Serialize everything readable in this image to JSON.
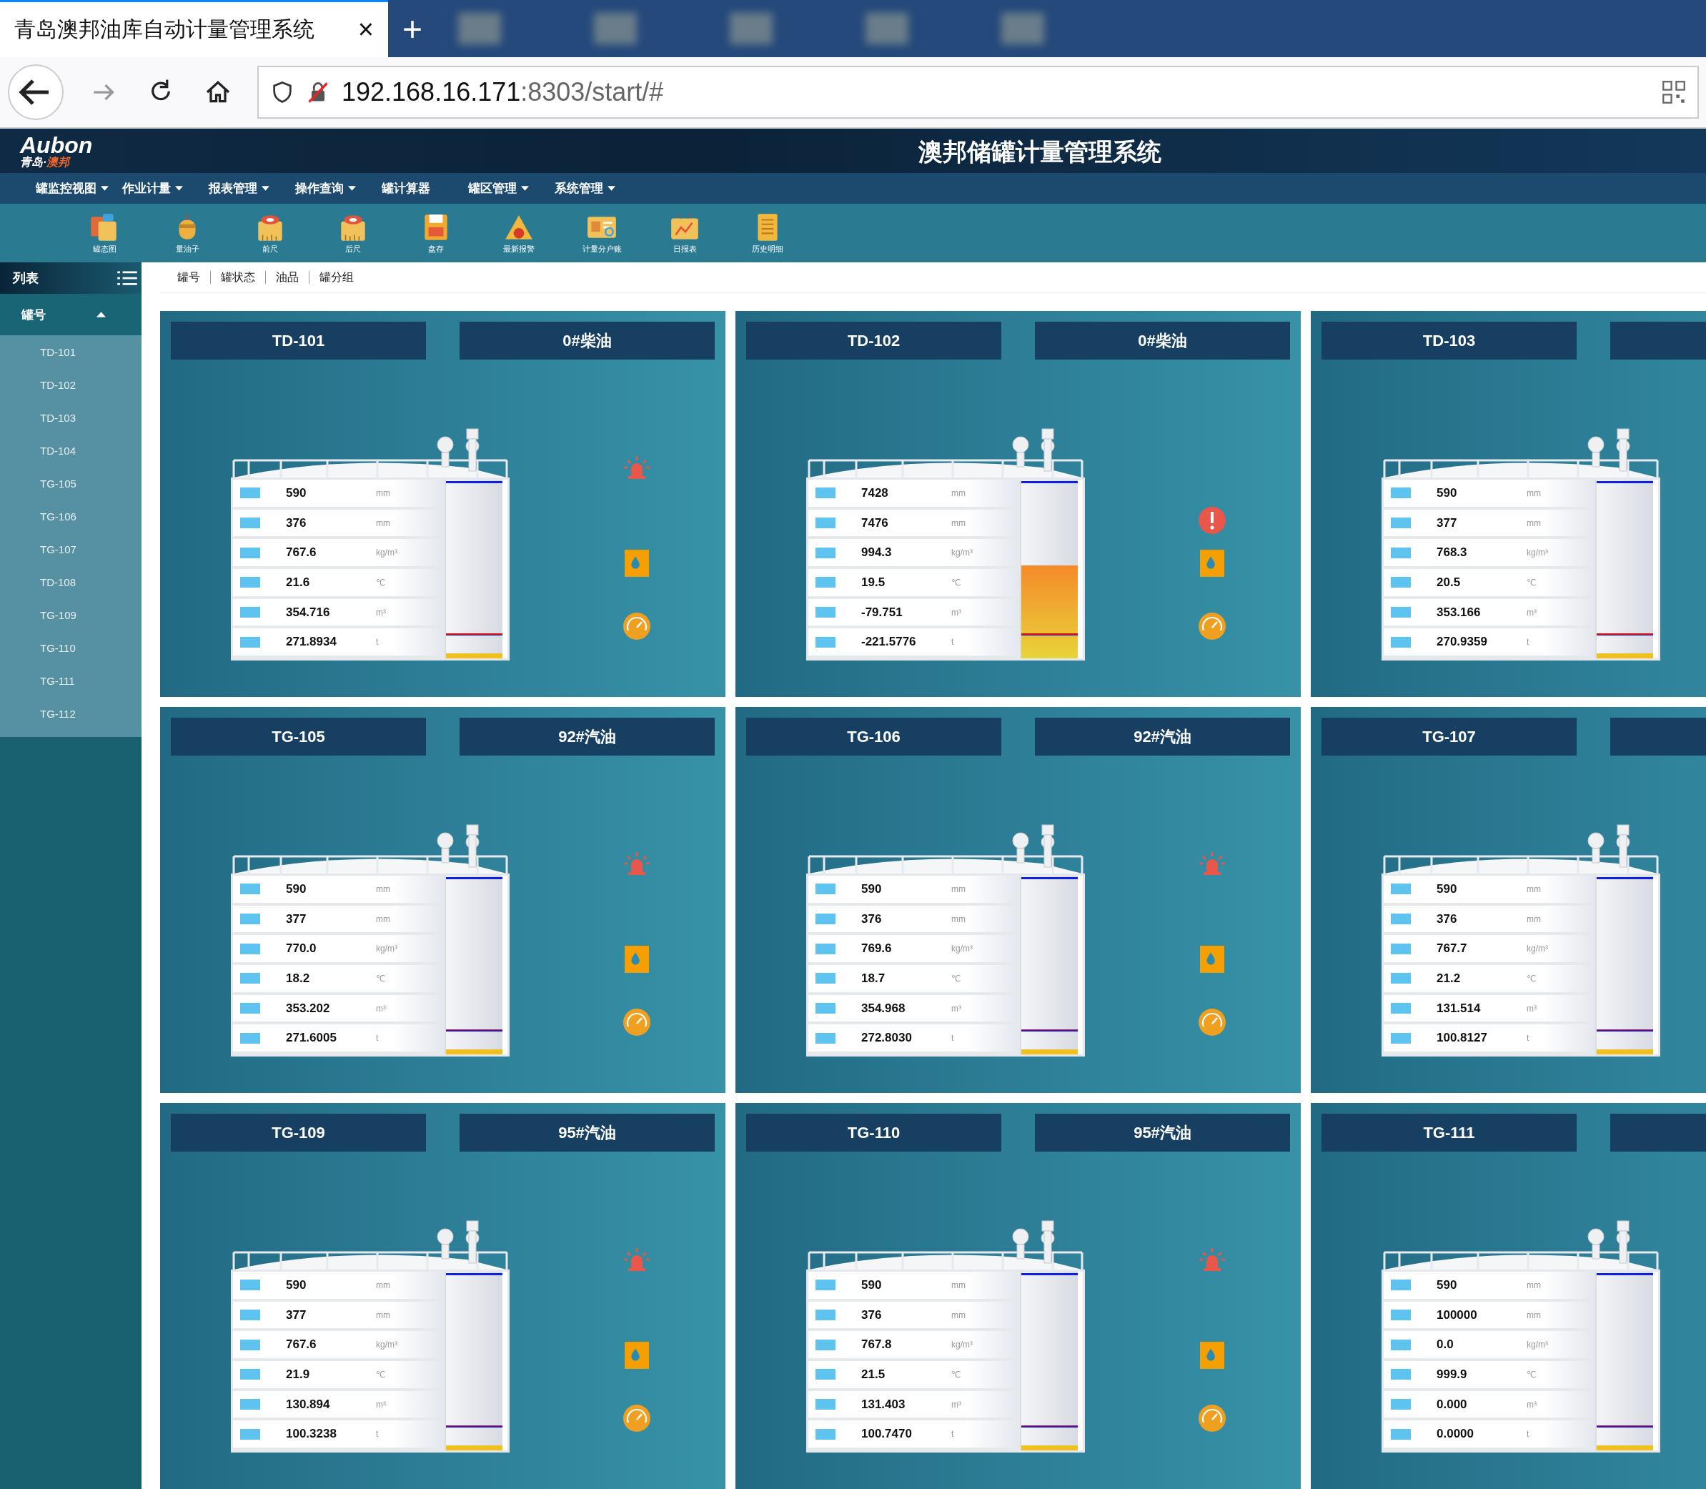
{
  "browser": {
    "tab_title": "青岛澳邦油库自动计量管理系统",
    "tab_close": "×",
    "new_tab": "+",
    "url_host": "192.168.16.171",
    "url_rest": ":8303/start/#"
  },
  "header": {
    "logo": "Aubon",
    "logo_sub": "青岛·",
    "logo_sub_accent": "澳邦",
    "title": "澳邦储罐计量管理系统"
  },
  "menu": [
    {
      "label": "罐监控视图",
      "dropdown": true
    },
    {
      "label": "作业计量",
      "dropdown": true
    },
    {
      "label": "报表管理",
      "dropdown": true
    },
    {
      "label": "操作查询",
      "dropdown": true
    },
    {
      "label": "罐计算器",
      "dropdown": false
    },
    {
      "label": "罐区管理",
      "dropdown": true
    },
    {
      "label": "系统管理",
      "dropdown": true
    }
  ],
  "toolbar": [
    {
      "label": "罐态图",
      "kind": "tanks"
    },
    {
      "label": "量油子",
      "kind": "drum"
    },
    {
      "label": "前尺",
      "kind": "ruler"
    },
    {
      "label": "后尺",
      "kind": "ruler"
    },
    {
      "label": "盘存",
      "kind": "save"
    },
    {
      "label": "最新报警",
      "kind": "warning"
    },
    {
      "label": "计量分户账",
      "kind": "card"
    },
    {
      "label": "日报表",
      "kind": "report"
    },
    {
      "label": "历史明细",
      "kind": "list"
    }
  ],
  "sidebar": {
    "title": "列表",
    "group": "罐号",
    "expanded": true,
    "items": [
      "TD-101",
      "TD-102",
      "TD-103",
      "TD-104",
      "TG-105",
      "TG-106",
      "TG-107",
      "TD-108",
      "TG-109",
      "TG-110",
      "TG-111",
      "TG-112"
    ]
  },
  "filters": [
    "罐号",
    "罐状态",
    "油品",
    "罐分组"
  ],
  "tanks": [
    {
      "name": "TD-101",
      "product": "0#柴油",
      "kind": "siren",
      "level": 0.03,
      "readings": [
        {
          "value": "590",
          "unit": "mm"
        },
        {
          "value": "376",
          "unit": "mm"
        },
        {
          "value": "767.6",
          "unit": "kg/m³"
        },
        {
          "value": "21.6",
          "unit": "℃"
        },
        {
          "value": "354.716",
          "unit": "m³"
        },
        {
          "value": "271.8934",
          "unit": "t"
        }
      ]
    },
    {
      "name": "TD-102",
      "product": "0#柴油",
      "kind": "error",
      "level": 0.52,
      "readings": [
        {
          "value": "7428",
          "unit": "mm"
        },
        {
          "value": "7476",
          "unit": "mm"
        },
        {
          "value": "994.3",
          "unit": "kg/m³"
        },
        {
          "value": "19.5",
          "unit": "℃"
        },
        {
          "value": "-79.751",
          "unit": "m³"
        },
        {
          "value": "-221.5776",
          "unit": "t"
        }
      ]
    },
    {
      "name": "TD-103",
      "kind": "none",
      "level": 0.03,
      "readings": [
        {
          "value": "590",
          "unit": "mm"
        },
        {
          "value": "377",
          "unit": "mm"
        },
        {
          "value": "768.3",
          "unit": "kg/m³"
        },
        {
          "value": "20.5",
          "unit": "℃"
        },
        {
          "value": "353.166",
          "unit": "m³"
        },
        {
          "value": "270.9359",
          "unit": "t"
        }
      ]
    },
    {
      "name": "TG-105",
      "product": "92#汽油",
      "kind": "siren",
      "level": 0.03,
      "readings": [
        {
          "value": "590",
          "unit": "mm"
        },
        {
          "value": "377",
          "unit": "mm"
        },
        {
          "value": "770.0",
          "unit": "kg/m³"
        },
        {
          "value": "18.2",
          "unit": "℃"
        },
        {
          "value": "353.202",
          "unit": "m³"
        },
        {
          "value": "271.6005",
          "unit": "t"
        }
      ]
    },
    {
      "name": "TG-106",
      "product": "92#汽油",
      "kind": "siren",
      "level": 0.03,
      "readings": [
        {
          "value": "590",
          "unit": "mm"
        },
        {
          "value": "376",
          "unit": "mm"
        },
        {
          "value": "769.6",
          "unit": "kg/m³"
        },
        {
          "value": "18.7",
          "unit": "℃"
        },
        {
          "value": "354.968",
          "unit": "m³"
        },
        {
          "value": "272.8030",
          "unit": "t"
        }
      ]
    },
    {
      "name": "TG-107",
      "kind": "none",
      "level": 0.03,
      "readings": [
        {
          "value": "590",
          "unit": "mm"
        },
        {
          "value": "376",
          "unit": "mm"
        },
        {
          "value": "767.7",
          "unit": "kg/m³"
        },
        {
          "value": "21.2",
          "unit": "℃"
        },
        {
          "value": "131.514",
          "unit": "m³"
        },
        {
          "value": "100.8127",
          "unit": "t"
        }
      ]
    },
    {
      "name": "TG-109",
      "product": "95#汽油",
      "kind": "siren",
      "level": 0.03,
      "readings": [
        {
          "value": "590",
          "unit": "mm"
        },
        {
          "value": "377",
          "unit": "mm"
        },
        {
          "value": "767.6",
          "unit": "kg/m³"
        },
        {
          "value": "21.9",
          "unit": "℃"
        },
        {
          "value": "130.894",
          "unit": "m³"
        },
        {
          "value": "100.3238",
          "unit": "t"
        }
      ]
    },
    {
      "name": "TG-110",
      "product": "95#汽油",
      "kind": "siren",
      "level": 0.03,
      "readings": [
        {
          "value": "590",
          "unit": "mm"
        },
        {
          "value": "376",
          "unit": "mm"
        },
        {
          "value": "767.8",
          "unit": "kg/m³"
        },
        {
          "value": "21.5",
          "unit": "℃"
        },
        {
          "value": "131.403",
          "unit": "m³"
        },
        {
          "value": "100.7470",
          "unit": "t"
        }
      ]
    },
    {
      "name": "TG-111",
      "kind": "none",
      "level": 0.03,
      "readings": [
        {
          "value": "590",
          "unit": "mm"
        },
        {
          "value": "100000",
          "unit": "mm"
        },
        {
          "value": "0.0",
          "unit": "kg/m³"
        },
        {
          "value": "999.9",
          "unit": "℃"
        },
        {
          "value": "0.000",
          "unit": "m³"
        },
        {
          "value": "0.0000",
          "unit": "t"
        }
      ]
    }
  ]
}
